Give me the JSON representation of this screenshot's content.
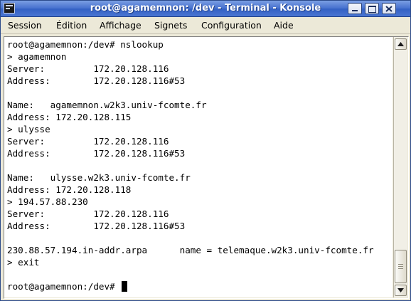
{
  "window": {
    "title": "root@agamemnon: /dev - Terminal - Konsole"
  },
  "titlebar_buttons": {
    "minimize_icon": "minimize-icon",
    "maximize_icon": "maximize-icon",
    "close_icon": "close-icon"
  },
  "menu": {
    "items": [
      "Session",
      "Édition",
      "Affichage",
      "Signets",
      "Configuration",
      "Aide"
    ]
  },
  "terminal": {
    "lines": [
      "root@agamemnon:/dev# nslookup",
      "> agamemnon",
      "Server:         172.20.128.116",
      "Address:        172.20.128.116#53",
      "",
      "Name:   agamemnon.w2k3.univ-fcomte.fr",
      "Address: 172.20.128.115",
      "> ulysse",
      "Server:         172.20.128.116",
      "Address:        172.20.128.116#53",
      "",
      "Name:   ulysse.w2k3.univ-fcomte.fr",
      "Address: 172.20.128.118",
      "> 194.57.88.230",
      "Server:         172.20.128.116",
      "Address:        172.20.128.116#53",
      "",
      "230.88.57.194.in-addr.arpa      name = telemaque.w2k3.univ-fcomte.fr",
      "> exit",
      "",
      "root@agamemnon:/dev# "
    ],
    "background_color": "#ffffff",
    "text_color": "#000000"
  },
  "scrollbar": {
    "up_icon": "arrow-up-icon",
    "down_icon": "arrow-down-icon"
  },
  "colors": {
    "titlebar": "#3461c4",
    "window_bg": "#ece9d8"
  }
}
